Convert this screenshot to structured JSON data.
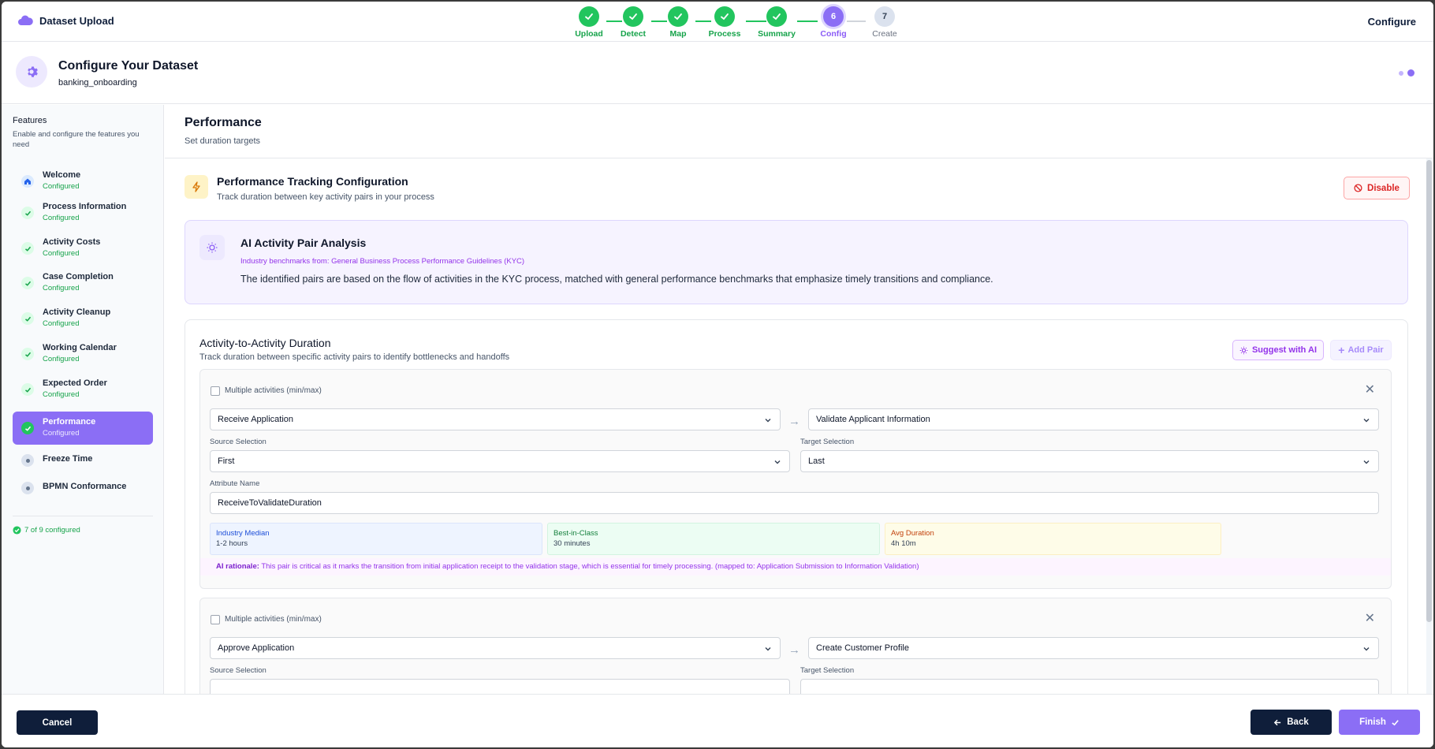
{
  "app": {
    "title": "Dataset Upload",
    "configure_link": "Configure"
  },
  "stepper": {
    "steps": [
      {
        "label": "Upload",
        "state": "done",
        "number": ""
      },
      {
        "label": "Detect",
        "state": "done",
        "number": ""
      },
      {
        "label": "Map",
        "state": "done",
        "number": ""
      },
      {
        "label": "Process",
        "state": "done",
        "number": ""
      },
      {
        "label": "Summary",
        "state": "done",
        "number": ""
      },
      {
        "label": "Config",
        "state": "active",
        "number": "6"
      },
      {
        "label": "Create",
        "state": "todo",
        "number": "7"
      }
    ]
  },
  "header": {
    "title": "Configure Your Dataset",
    "subtitle": "banking_onboarding",
    "icon": "gear-icon"
  },
  "sidebar": {
    "title": "Features",
    "description": "Enable and configure the features you need",
    "items": [
      {
        "name": "Welcome",
        "status": "Configured",
        "icon": "home-icon"
      },
      {
        "name": "Process Information",
        "status": "Configured",
        "icon": "check-icon"
      },
      {
        "name": "Activity Costs",
        "status": "Configured",
        "icon": "check-icon"
      },
      {
        "name": "Case Completion",
        "status": "Configured",
        "icon": "check-icon"
      },
      {
        "name": "Activity Cleanup",
        "status": "Configured",
        "icon": "check-icon"
      },
      {
        "name": "Working Calendar",
        "status": "Configured",
        "icon": "check-icon"
      },
      {
        "name": "Expected Order",
        "status": "Configured",
        "icon": "check-icon"
      },
      {
        "name": "Performance",
        "status": "Configured",
        "icon": "check-icon"
      },
      {
        "name": "Freeze Time",
        "status": "",
        "icon": "dot-icon"
      },
      {
        "name": "BPMN Conformance",
        "status": "",
        "icon": "dot-icon"
      }
    ],
    "summary": "7 of 9 configured"
  },
  "main": {
    "title": "Performance",
    "subtitle": "Set duration targets",
    "tracking": {
      "title": "Performance Tracking Configuration",
      "subtitle": "Track duration between key activity pairs in your process",
      "disable_label": "Disable"
    },
    "ai": {
      "title": "AI Activity Pair Analysis",
      "benchmark": "Industry benchmarks from: General Business Process Performance Guidelines (KYC)",
      "description": "The identified pairs are based on the flow of activities in the KYC process, matched with general performance benchmarks that emphasize timely transitions and compliance."
    },
    "duration": {
      "title": "Activity-to-Activity Duration",
      "subtitle": "Track duration between specific activity pairs to identify bottlenecks and handoffs",
      "suggest_label": "Suggest with AI",
      "add_label": "Add Pair",
      "pairs": [
        {
          "multiple_label": "Multiple activities (min/max)",
          "source": "Receive Application",
          "target": "Validate Applicant Information",
          "source_selection_label": "Source Selection",
          "source_selection": "First",
          "target_selection_label": "Target Selection",
          "target_selection": "Last",
          "attribute_label": "Attribute Name",
          "attribute": "ReceiveToValidateDuration",
          "median_label": "Industry Median",
          "median": "1-2 hours",
          "best_label": "Best-in-Class",
          "best": "30 minutes",
          "avg_label": "Avg Duration",
          "avg": "4h 10m",
          "rationale_label": "AI rationale:",
          "rationale": "This pair is critical as it marks the transition from initial application receipt to the validation stage, which is essential for timely processing.",
          "mapped": "(mapped to: Application Submission to Information Validation)"
        },
        {
          "multiple_label": "Multiple activities (min/max)",
          "source": "Approve Application",
          "target": "Create Customer Profile",
          "source_selection_label": "Source Selection",
          "target_selection_label": "Target Selection"
        }
      ]
    }
  },
  "footer": {
    "cancel_label": "Cancel",
    "back_label": "Back",
    "finish_label": "Finish"
  },
  "colors": {
    "accent": "#8b6ef5",
    "success": "#22c55e",
    "navy": "#0f1e3a",
    "danger": "#dc2626"
  }
}
